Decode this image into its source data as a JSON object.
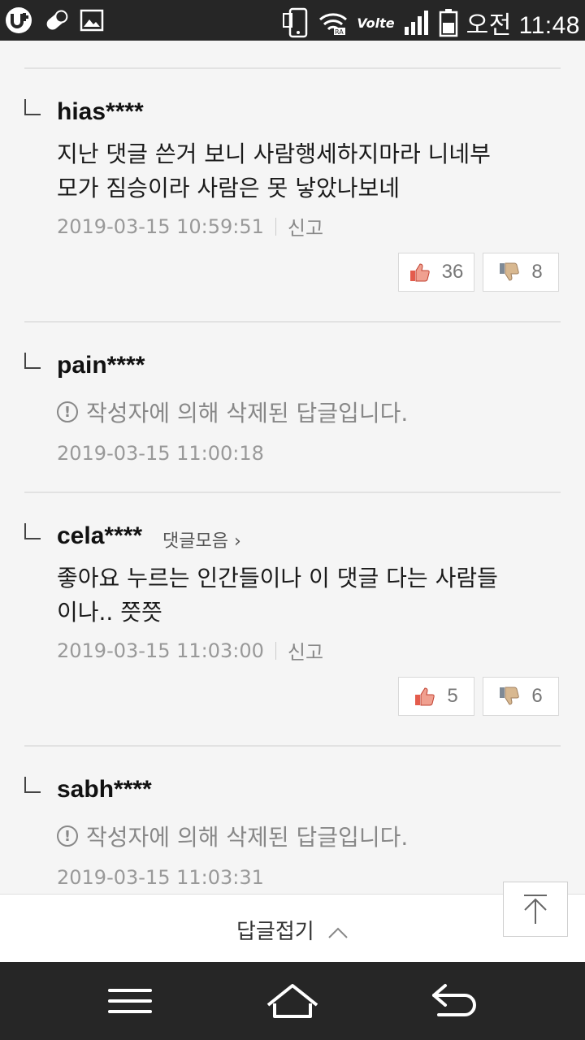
{
  "status_bar": {
    "time": "오전 11:48",
    "network": "Volte",
    "icons": [
      "u-plus-icon",
      "pill-icon",
      "image-icon",
      "phone-icon",
      "wifi-icon",
      "signal-icon",
      "battery-icon"
    ]
  },
  "replies": [
    {
      "nickname": "hias****",
      "text_lines": [
        "지난 댓글 쓴거 보니 사람행세하지마라 니네부",
        "모가 짐승이라 사람은 못 낳았나보네"
      ],
      "date": "2019-03-15 10:59:51",
      "report_label": "신고",
      "likes": "36",
      "dislikes": "8"
    },
    {
      "nickname": "pain****",
      "deleted_text": "작성자에 의해 삭제된 답글입니다.",
      "date": "2019-03-15 11:00:18"
    },
    {
      "nickname": "cela****",
      "collect_label": "댓글모음",
      "text_lines": [
        "좋아요 누르는 인간들이나 이 댓글 다는 사람들",
        "이나.. 쯧쯧"
      ],
      "date": "2019-03-15 11:03:00",
      "report_label": "신고",
      "likes": "5",
      "dislikes": "6"
    },
    {
      "nickname": "sabh****",
      "deleted_text": "작성자에 의해 삭제된 답글입니다.",
      "date": "2019-03-15 11:03:31"
    }
  ],
  "fold_bar": {
    "label": "답글접기"
  },
  "colors": {
    "like_red": "#e45c4c",
    "dislike_gray": "#9aa3ad",
    "bar_dark": "#262626"
  }
}
